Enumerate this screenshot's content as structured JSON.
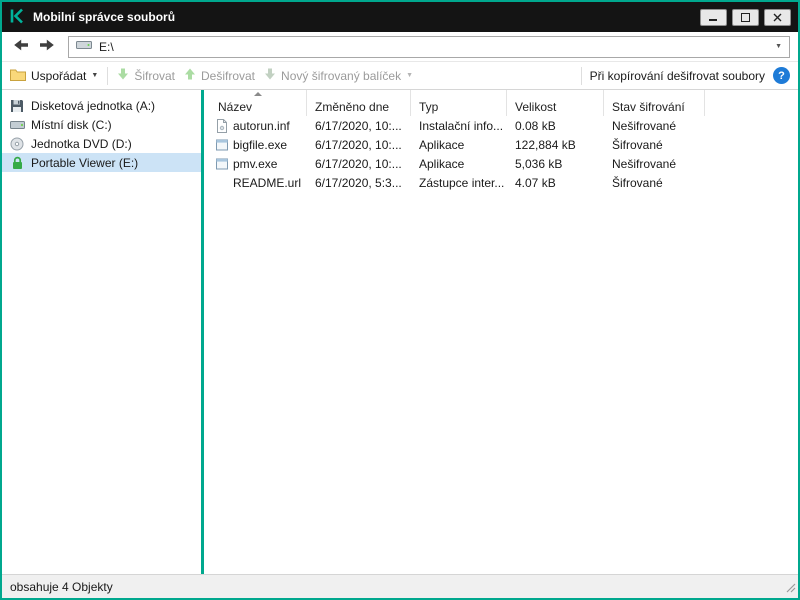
{
  "window": {
    "title": "Mobilní správce souborů"
  },
  "colors": {
    "accent": "#00a88e",
    "titlebar": "#141414",
    "selection": "#cce3f6",
    "help_blue": "#1e7bd7",
    "disabled_text": "#9b9b9b"
  },
  "nav": {
    "address": "E:\\",
    "back_icon": "arrow-left",
    "forward_icon": "arrow-right",
    "dropdown_glyph": "▼"
  },
  "toolbar": {
    "organize": "Uspořádat",
    "organize_caret": "▼",
    "encrypt": "Šifrovat",
    "decrypt": "Dešifrovat",
    "new_package": "Nový šifrovaný balíček",
    "package_caret": "▼",
    "copy_decrypt_label": "Při kopírování dešifrovat soubory",
    "help_glyph": "?"
  },
  "sidebar": {
    "items": [
      {
        "label": "Disketová jednotka (A:)",
        "icon": "floppy-drive-icon",
        "selected": false
      },
      {
        "label": "Místní disk (C:)",
        "icon": "hard-drive-icon",
        "selected": false
      },
      {
        "label": "Jednotka DVD (D:)",
        "icon": "dvd-drive-icon",
        "selected": false
      },
      {
        "label": "Portable Viewer (E:)",
        "icon": "encrypted-drive-lock-icon",
        "selected": true
      }
    ]
  },
  "files": {
    "columns": [
      "Název",
      "Změněno dne",
      "Typ",
      "Velikost",
      "Stav šifrování"
    ],
    "sorted_column": "Název",
    "rows": [
      {
        "name": "autorun.inf",
        "modified": "6/17/2020, 10:...",
        "type": "Instalační info...",
        "size": "0.08 kB",
        "encryption": "Nešifrované",
        "icon": "setup-info-file-icon"
      },
      {
        "name": "bigfile.exe",
        "modified": "6/17/2020, 10:...",
        "type": "Aplikace",
        "size": "122,884 kB",
        "encryption": "Šifrované",
        "icon": "application-file-icon"
      },
      {
        "name": "pmv.exe",
        "modified": "6/17/2020, 10:...",
        "type": "Aplikace",
        "size": "5,036 kB",
        "encryption": "Nešifrované",
        "icon": "application-file-icon"
      },
      {
        "name": "README.url",
        "modified": "6/17/2020, 5:3...",
        "type": "Zástupce inter...",
        "size": "4.07 kB",
        "encryption": "Šifrované",
        "icon": "none"
      }
    ]
  },
  "statusbar": {
    "text": "obsahuje 4 Objekty"
  }
}
